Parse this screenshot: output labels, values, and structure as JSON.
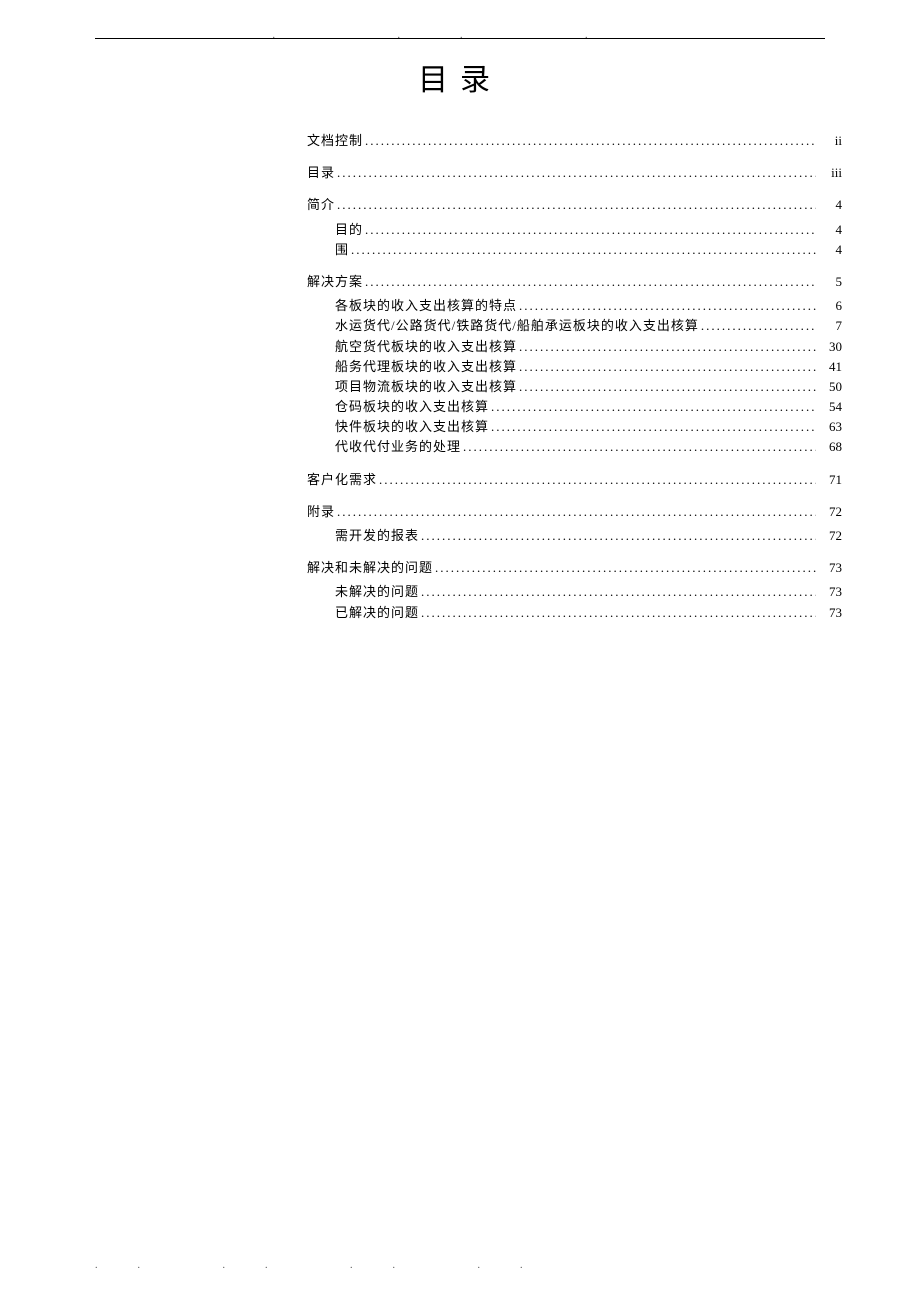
{
  "title": "目录",
  "toc": [
    {
      "level": 0,
      "label": "文档控制",
      "page": "ii"
    },
    {
      "level": 0,
      "label": "目录",
      "page": "iii"
    },
    {
      "level": 0,
      "label": "简介",
      "page": "4"
    },
    {
      "level": 1,
      "label": "目的",
      "page": "4",
      "subgroup_start": true
    },
    {
      "level": 1,
      "label": "围",
      "page": "4"
    },
    {
      "level": 0,
      "label": "解决方案",
      "page": "5"
    },
    {
      "level": 1,
      "label": "各板块的收入支出核算的特点",
      "page": "6",
      "subgroup_start": true
    },
    {
      "level": 1,
      "label": "水运货代/公路货代/铁路货代/船舶承运板块的收入支出核算",
      "page": "7"
    },
    {
      "level": 1,
      "label": "航空货代板块的收入支出核算",
      "page": "30"
    },
    {
      "level": 1,
      "label": "船务代理板块的收入支出核算",
      "page": "41"
    },
    {
      "level": 1,
      "label": "项目物流板块的收入支出核算",
      "page": "50"
    },
    {
      "level": 1,
      "label": "仓码板块的收入支出核算",
      "page": "54"
    },
    {
      "level": 1,
      "label": "快件板块的收入支出核算",
      "page": "63"
    },
    {
      "level": 1,
      "label": "代收代付业务的处理",
      "page": "68"
    },
    {
      "level": 0,
      "label": "客户化需求",
      "page": "71"
    },
    {
      "level": 0,
      "label": "附录",
      "page": "72"
    },
    {
      "level": 1,
      "label": "需开发的报表",
      "page": "72",
      "subgroup_start": true
    },
    {
      "level": 0,
      "label": "解决和未解决的问题",
      "page": "73"
    },
    {
      "level": 1,
      "label": "未解决的问题",
      "page": "73",
      "subgroup_start": true
    },
    {
      "level": 1,
      "label": "已解决的问题",
      "page": "73"
    }
  ]
}
